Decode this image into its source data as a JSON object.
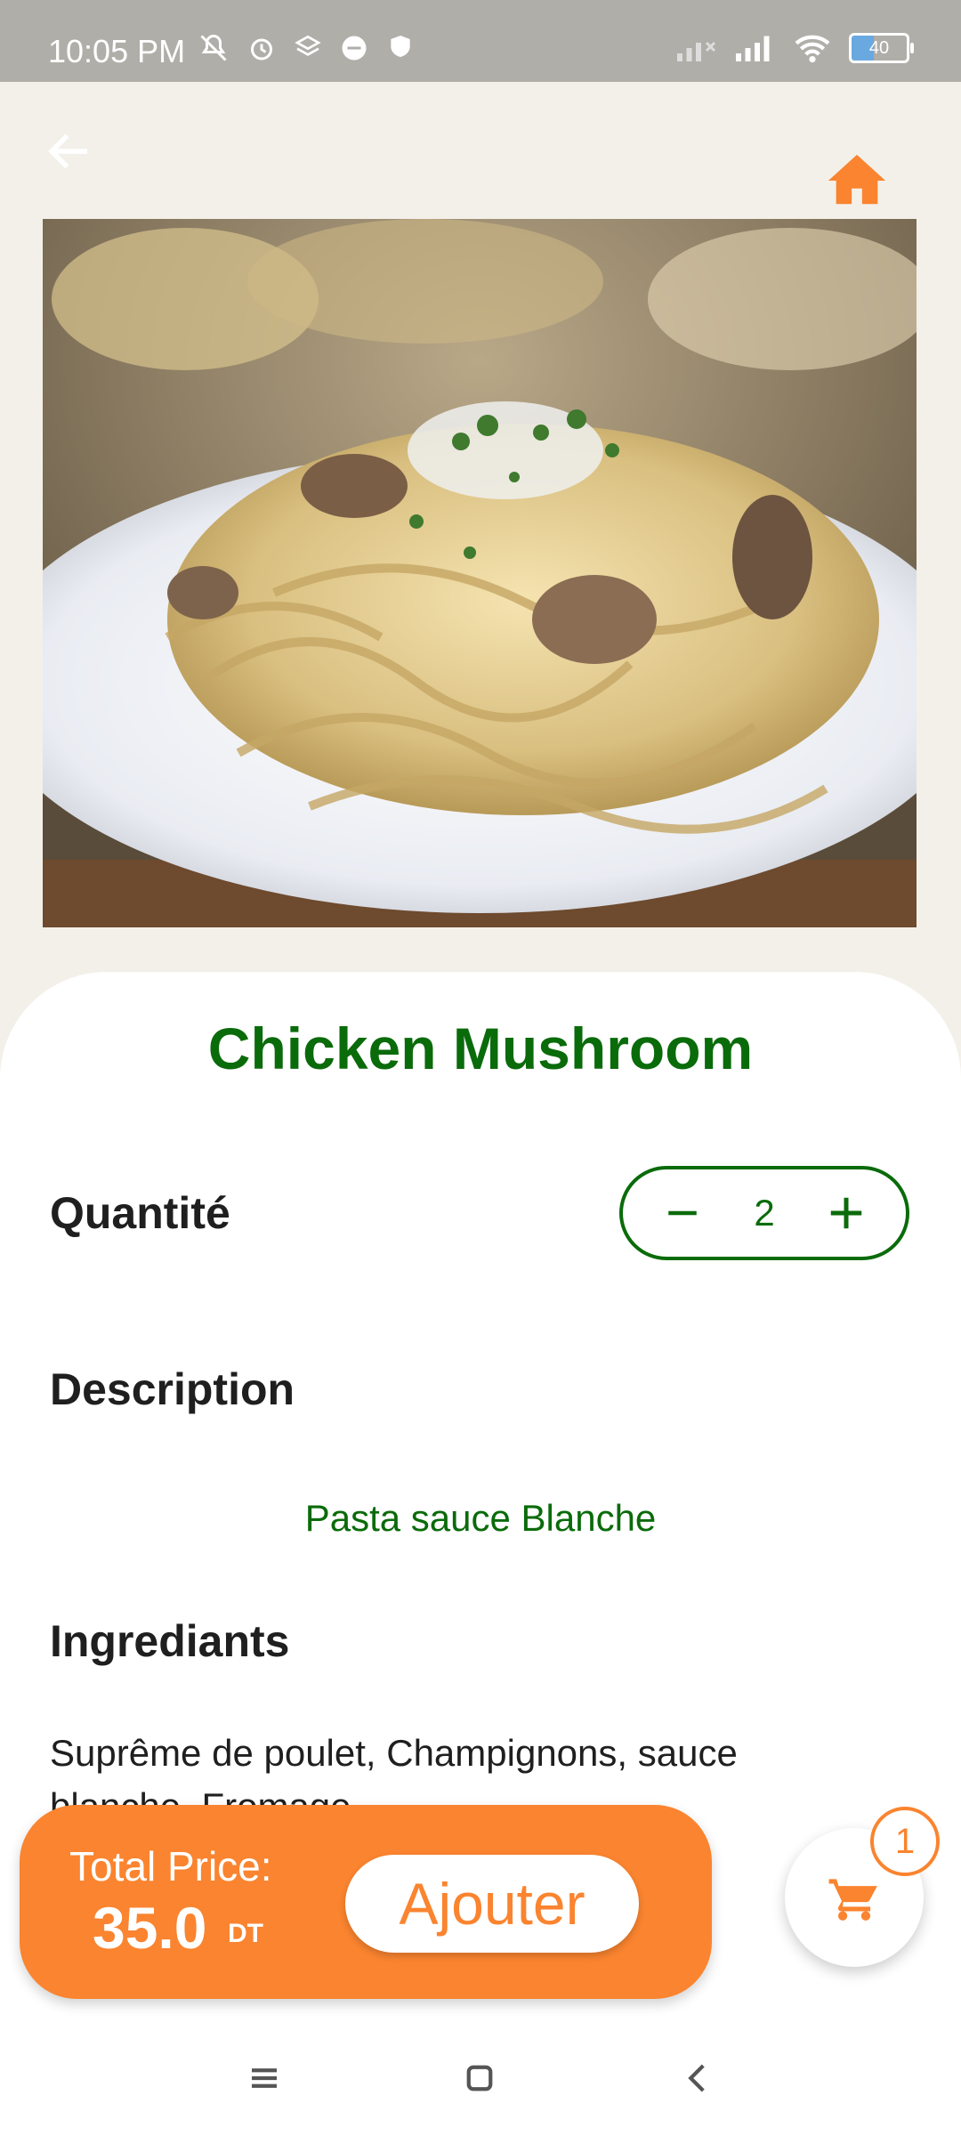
{
  "status_bar": {
    "time": "10:05 PM",
    "battery": "40"
  },
  "nav": {
    "back_icon": "arrow-left-icon",
    "home_icon": "home-icon"
  },
  "dish": {
    "title": "Chicken Mushroom"
  },
  "quantity": {
    "label": "Quantité",
    "value": "2"
  },
  "description": {
    "label": "Description",
    "text": "Pasta sauce Blanche"
  },
  "ingredients": {
    "label": "Ingrediants",
    "text": "Suprême de poulet, Champignons, sauce blanche, Fromage"
  },
  "price_bar": {
    "label": "Total Price:",
    "value": "35.0",
    "unit": "DT",
    "add_label": "Ajouter"
  },
  "cart": {
    "count": "1"
  },
  "colors": {
    "brand_orange": "#fa842f",
    "brand_green": "#0a6b0a",
    "background": "#f3f0ea"
  }
}
